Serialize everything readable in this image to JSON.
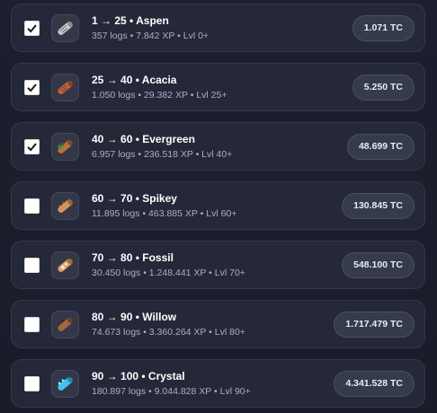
{
  "rows": [
    {
      "title": "1 → 25 • Aspen",
      "sub": "357 logs • 7.842 XP • Lvl 0+",
      "price": "1.071 TC",
      "checked": true,
      "icon": "aspen-log-icon",
      "color": "#c9c9c9"
    },
    {
      "title": "25 → 40 • Acacia",
      "sub": "1.050 logs • 29.382 XP • Lvl 25+",
      "price": "5.250 TC",
      "checked": true,
      "icon": "acacia-log-icon",
      "color": "#c0643a"
    },
    {
      "title": "40 → 60 • Evergreen",
      "sub": "6.957 logs • 236.518 XP • Lvl 40+",
      "price": "48.699 TC",
      "checked": true,
      "icon": "evergreen-log-icon",
      "color": "#b9733e"
    },
    {
      "title": "60 → 70 • Spikey",
      "sub": "11.895 logs • 463.885 XP • Lvl 60+",
      "price": "130.845 TC",
      "checked": false,
      "icon": "spikey-log-icon",
      "color": "#d4955a"
    },
    {
      "title": "70 → 80 • Fossil",
      "sub": "30.450 logs • 1.248.441 XP • Lvl 70+",
      "price": "548.100 TC",
      "checked": false,
      "icon": "fossil-log-icon",
      "color": "#d8a367"
    },
    {
      "title": "80 → 90 • Willow",
      "sub": "74.673 logs • 3.360.264 XP • Lvl 80+",
      "price": "1.717.479 TC",
      "checked": false,
      "icon": "willow-log-icon",
      "color": "#a4683f"
    },
    {
      "title": "90 → 100 • Crystal",
      "sub": "180.897 logs • 9.044.828 XP • Lvl 90+",
      "price": "4.341.528 TC",
      "checked": false,
      "icon": "crystal-log-icon",
      "color": "#3fc7e8"
    }
  ]
}
